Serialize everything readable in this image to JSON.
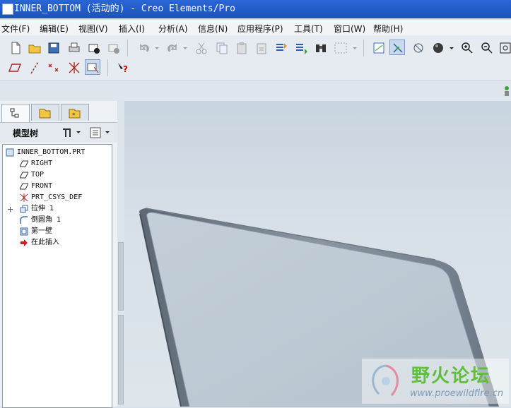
{
  "window": {
    "title": "INNER_BOTTOM (活动的) - Creo Elements/Pro"
  },
  "menu": [
    "文件(F)",
    "编辑(E)",
    "视图(V)",
    "插入(I)",
    "分析(A)",
    "信息(N)",
    "应用程序(P)",
    "工具(T)",
    "窗口(W)",
    "帮助(H)"
  ],
  "model_tree": {
    "title": "模型树",
    "items": [
      {
        "label": "INNER_BOTTOM.PRT",
        "icon": "part-icon"
      },
      {
        "label": "RIGHT",
        "icon": "datum-plane-icon"
      },
      {
        "label": "TOP",
        "icon": "datum-plane-icon"
      },
      {
        "label": "FRONT",
        "icon": "datum-plane-icon"
      },
      {
        "label": "PRT_CSYS_DEF",
        "icon": "csys-icon"
      },
      {
        "label": "拉伸 1",
        "icon": "extrude-icon"
      },
      {
        "label": "倒圆角 1",
        "icon": "round-icon"
      },
      {
        "label": "第一壁",
        "icon": "shell-icon"
      },
      {
        "label": "在此插入",
        "icon": "insert-here-arrow-icon"
      }
    ]
  },
  "watermark": {
    "title": "野火论坛",
    "url": "www.proewildfire.cn"
  },
  "colors": {
    "titlebar": "#1d53b8",
    "viewport_bg": "#d7e0e8",
    "model_edge": "#5b6773"
  }
}
